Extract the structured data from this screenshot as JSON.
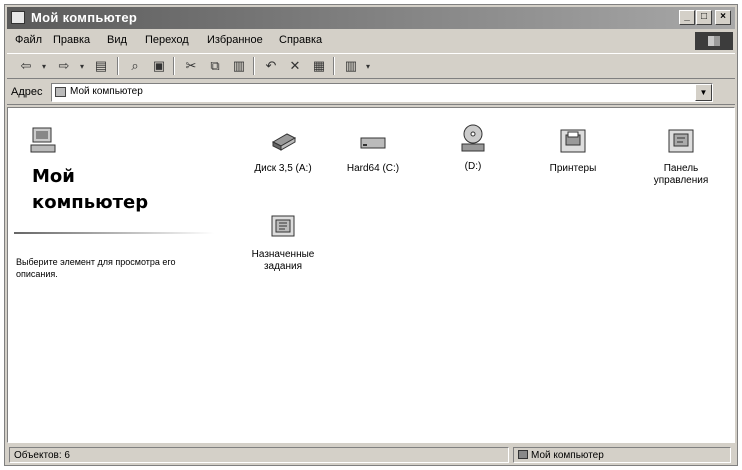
{
  "window": {
    "title": "Мой компьютер"
  },
  "menu": [
    {
      "label": "Файл"
    },
    {
      "label": "Правка"
    },
    {
      "label": "Вид"
    },
    {
      "label": "Переход"
    },
    {
      "label": "Избранное"
    },
    {
      "label": "Справка"
    }
  ],
  "address": {
    "label": "Адрес",
    "value": "Мой компьютер"
  },
  "left_pane": {
    "title_line1": "Мой",
    "title_line2": "компьютер",
    "description": "Выберите элемент для просмотра его описания."
  },
  "items": [
    {
      "label": "Диск 3,5 (A:)",
      "icon": "floppy-drive-icon"
    },
    {
      "label": "Hard64 (C:)",
      "icon": "hard-drive-icon"
    },
    {
      "label": "(D:)",
      "icon": "cd-drive-icon"
    },
    {
      "label": "Принтеры",
      "icon": "printers-folder-icon"
    },
    {
      "label": "Панель управления",
      "icon": "control-panel-icon"
    },
    {
      "label": "Назначенные задания",
      "icon": "scheduled-tasks-icon"
    }
  ],
  "status": {
    "objects": "Объектов: 6",
    "location": "Мой компьютер"
  }
}
